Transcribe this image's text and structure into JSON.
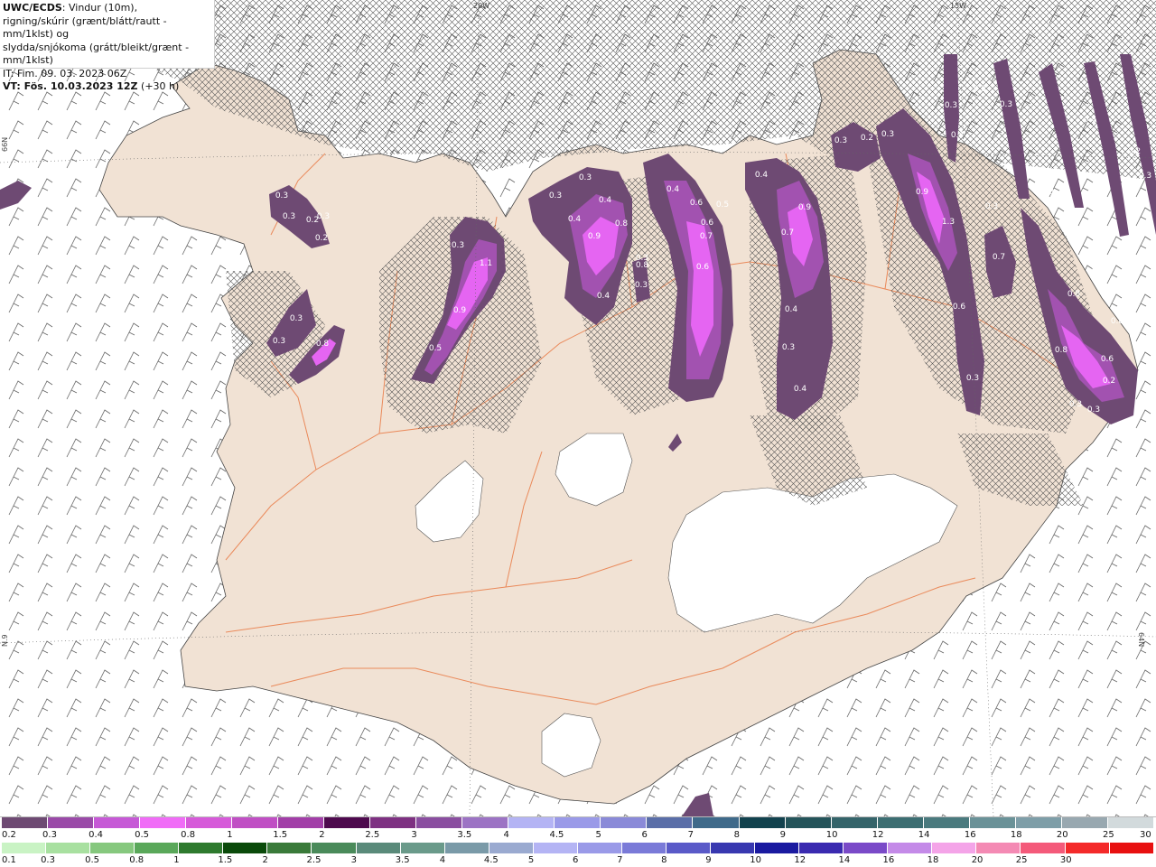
{
  "header": {
    "line1_bold": "UWC/ECDS",
    "line1_rest": ": Vindur (10m),",
    "line2": "rigning/skúrir (grænt/blátt/rautt - mm/1klst) og",
    "line3": "slydda/snjókoma (grátt/bleikt/grænt - mm/1klst)",
    "line4": "IT: Fim. 09. 03. 2023 06Z",
    "line5_bold": "VT: Fös. 10.03.2023 12Z",
    "line5_rest": " (+30 h)"
  },
  "grid_labels": [
    "20W",
    "15W",
    "66N",
    "64N",
    "N.9"
  ],
  "map_values": [
    "0.3",
    "0.3",
    "0.2",
    "0.3",
    "0.2",
    "0.3",
    "1.1",
    "0.9",
    "0.5",
    "0.3",
    "0.3",
    "0.4",
    "0.9",
    "0.4",
    "0.8",
    "0.4",
    "0.8",
    "0.3",
    "0.3",
    "0.4",
    "0.6",
    "0.5",
    "0.6",
    "0.7",
    "0.6",
    "0.4",
    "0.9",
    "0.7",
    "0.4",
    "0.3",
    "0.4",
    "0.3",
    "0.2",
    "0.3",
    "0.9",
    "1.3",
    "0.4",
    "0.3",
    "0.7",
    "0.6",
    "0.3",
    "0.3",
    "0.8",
    "0.6",
    "0.8",
    "0.6",
    "0.2",
    "0.3",
    "0.3",
    "0.3",
    "0.3",
    "0.3",
    "0.4",
    "0.2",
    "0.3",
    "0.8",
    "0.3",
    "0.3",
    "0.8"
  ],
  "colors": {
    "land": "#f1e2d4",
    "sea": "#ffffff",
    "glacier": "#ffffff",
    "roads": "#e97a45",
    "snow_dark": "#6e4a73",
    "snow_mid": "#a252b0",
    "snow_light": "#e565f2"
  },
  "legend": {
    "snow": {
      "labels": [
        "0.2",
        "0.3",
        "0.4",
        "0.5",
        "0.8",
        "1",
        "1.5",
        "2",
        "2.5",
        "3",
        "3.5",
        "4",
        "4.5",
        "5",
        "6",
        "7",
        "8",
        "9",
        "10",
        "12",
        "14",
        "16",
        "18",
        "20",
        "25",
        "30"
      ],
      "colors": [
        "#6e4a73",
        "#9a4aa8",
        "#c659d6",
        "#f06cf7",
        "#d65ad9",
        "#c04fc4",
        "#a23ea8",
        "#4e0a4e",
        "#7e3182",
        "#8a4ea0",
        "#9c73c4",
        "#b4b4f4",
        "#9a9ae8",
        "#8a8ad8",
        "#5a6ea8",
        "#3f6a8a",
        "#12424e",
        "#24545a",
        "#34646a",
        "#3c6e72",
        "#4a7a7e",
        "#6a9298",
        "#7e9ea8",
        "#98a8b0",
        "#d2dadc"
      ]
    },
    "rain": {
      "labels": [
        "0.1",
        "0.3",
        "0.5",
        "0.8",
        "1",
        "1.5",
        "2",
        "2.5",
        "3",
        "3.5",
        "4",
        "4.5",
        "5",
        "6",
        "7",
        "8",
        "9",
        "10",
        "12",
        "14",
        "16",
        "18",
        "20",
        "25",
        "30"
      ],
      "colors": [
        "#c9f3c4",
        "#a8e0a0",
        "#86c87e",
        "#5aa85a",
        "#2e7a2e",
        "#0a4a0a",
        "#3a7a3a",
        "#4a8a5a",
        "#5a8a7a",
        "#6a9a8a",
        "#7a9aa8",
        "#9aaad0",
        "#b4b4f4",
        "#9a9ae8",
        "#7a7ad8",
        "#5a5ac8",
        "#3838b0",
        "#1a1aa0",
        "#3a2ab0",
        "#7a4ac8",
        "#c48ae8",
        "#f4a4e8",
        "#f48ab4",
        "#f45a7a",
        "#f42a2a",
        "#e81010"
      ]
    }
  }
}
